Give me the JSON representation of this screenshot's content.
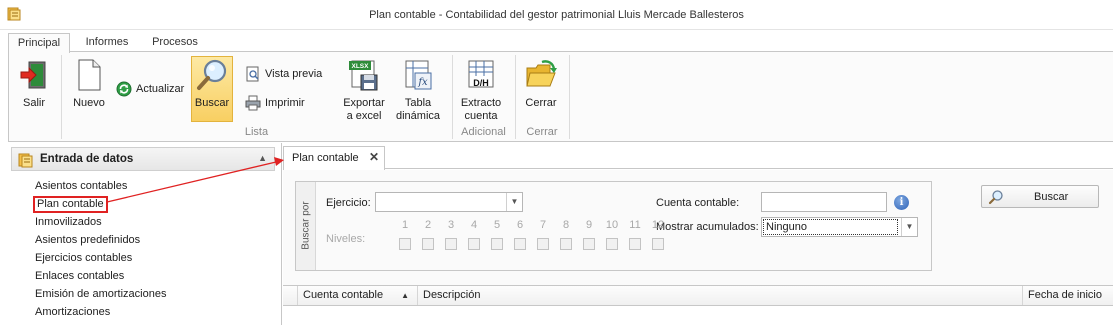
{
  "window": {
    "title": "Plan contable - Contabilidad del gestor patrimonial Lluis Mercade Ballesteros"
  },
  "ribbon_tabs": [
    "Principal",
    "Informes",
    "Procesos"
  ],
  "ribbon": {
    "salir": "Salir",
    "nuevo": "Nuevo",
    "actualizar": "Actualizar",
    "buscar": "Buscar",
    "vista_previa": "Vista previa",
    "imprimir": "Imprimir",
    "exportar_line1": "Exportar",
    "exportar_line2": "a excel",
    "tabla_line1": "Tabla",
    "tabla_line2": "dinámica",
    "extracto_line1": "Extracto",
    "extracto_line2": "cuenta",
    "cerrar": "Cerrar",
    "group_lista": "Lista",
    "group_adicional": "Adicional",
    "group_cerrar": "Cerrar",
    "xlsx_badge": "XLSX",
    "fx_badge": "fx",
    "dh_badge": "D/H"
  },
  "nav": {
    "header": "Entrada de datos",
    "items": [
      "Asientos contables",
      "Plan contable",
      "Inmovilizados",
      "Asientos predefinidos",
      "Ejercicios contables",
      "Enlaces contables",
      "Emisión de amortizaciones",
      "Amortizaciones"
    ],
    "selected": "Plan contable"
  },
  "doc_tab": {
    "label": "Plan contable",
    "close": "✕"
  },
  "search": {
    "group_label": "Buscar por",
    "ejercicio_label": "Ejercicio:",
    "ejercicio_value": "",
    "niveles_label": "Niveles:",
    "levels": [
      "1",
      "2",
      "3",
      "4",
      "5",
      "6",
      "7",
      "8",
      "9",
      "10",
      "11",
      "12"
    ],
    "cuenta_label": "Cuenta contable:",
    "cuenta_value": "",
    "mostrar_label": "Mostrar acumulados:",
    "mostrar_value": "Ninguno",
    "buscar_button": "Buscar"
  },
  "grid": {
    "columns": [
      "Cuenta contable",
      "Descripción",
      "Fecha de inicio"
    ]
  },
  "colors": {
    "accent_active": "#f8cf62",
    "highlight_red": "#e02222",
    "info_blue": "#2f63b8"
  }
}
